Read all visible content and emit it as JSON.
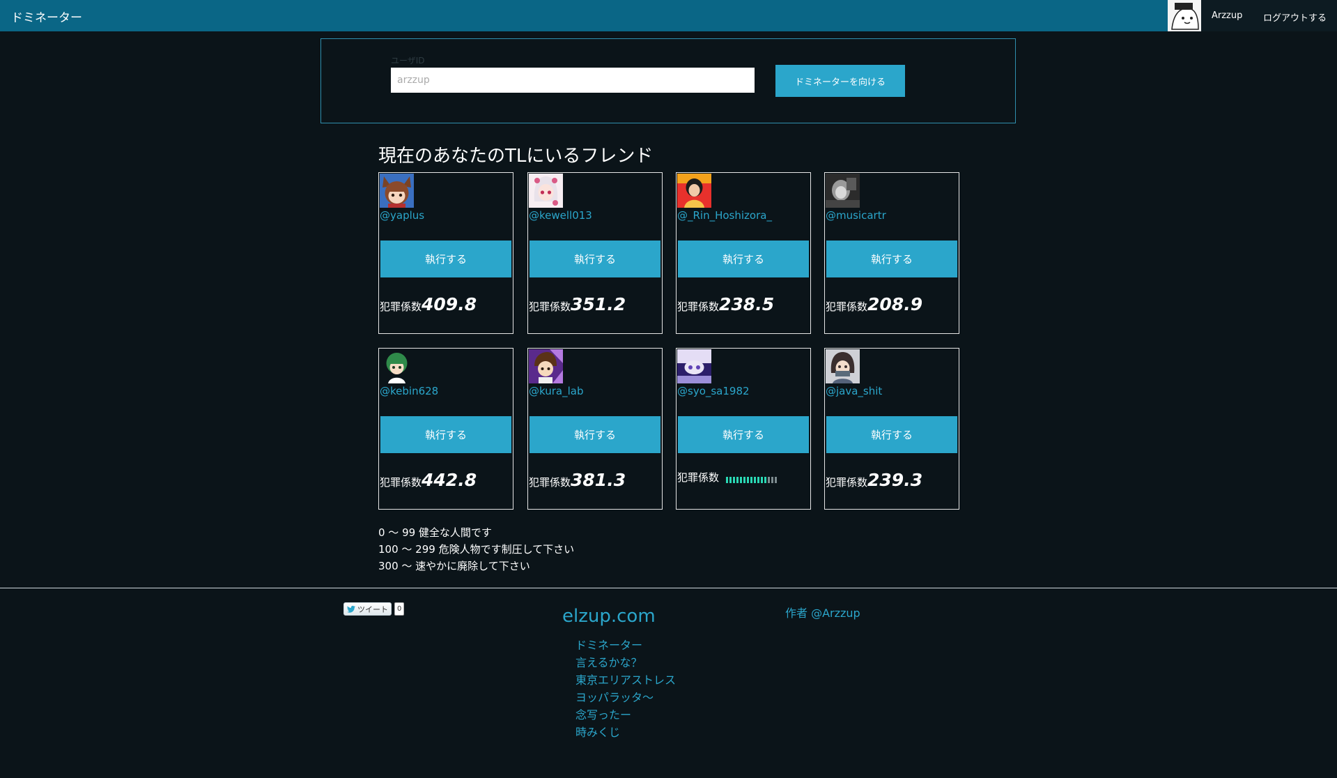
{
  "header": {
    "brand": "ドミネーター",
    "user_name": "Arzzup",
    "logout_label": "ログアウトする"
  },
  "form": {
    "field_label": "ユーザID",
    "placeholder": "arzzup",
    "submit_label": "ドミネーターを向ける"
  },
  "section_title": "現在のあなたのTLにいるフレンド",
  "friends": [
    {
      "handle": "@yaplus",
      "exec_label": "執行する",
      "score_label": "犯罪係数",
      "score": "409.8"
    },
    {
      "handle": "@kewell013",
      "exec_label": "執行する",
      "score_label": "犯罪係数",
      "score": "351.2"
    },
    {
      "handle": "@_Rin_Hoshizora_",
      "exec_label": "執行する",
      "score_label": "犯罪係数",
      "score": "238.5"
    },
    {
      "handle": "@musicartr",
      "exec_label": "執行する",
      "score_label": "犯罪係数",
      "score": "208.9"
    },
    {
      "handle": "@kebin628",
      "exec_label": "執行する",
      "score_label": "犯罪係数",
      "score": "442.8"
    },
    {
      "handle": "@kura_lab",
      "exec_label": "執行する",
      "score_label": "犯罪係数",
      "score": "381.3"
    },
    {
      "handle": "@syo_sa1982",
      "exec_label": "執行する",
      "score_label": "犯罪係数",
      "gauge_level": 0.8
    },
    {
      "handle": "@java_shit",
      "exec_label": "執行する",
      "score_label": "犯罪係数",
      "score": "239.3"
    }
  ],
  "legend": [
    "0 〜 99 健全な人間です",
    "100 〜 299 危険人物です制圧して下さい",
    "300 〜 速やかに廃除して下さい"
  ],
  "footer": {
    "tweet_label": "ツイート",
    "tweet_count": "0",
    "site_title": "elzup.com",
    "links": [
      "ドミネーター",
      "言えるかな？",
      "東京エリアストレス",
      "ヨッパラッタ〜",
      "念写ったー",
      "時みくじ"
    ],
    "author": "作者 @Arzzup"
  },
  "colors": {
    "background": "#0b1419",
    "topbar": "#0a6686",
    "accent": "#2ba6cb",
    "gauge": "#2ad8b4"
  }
}
